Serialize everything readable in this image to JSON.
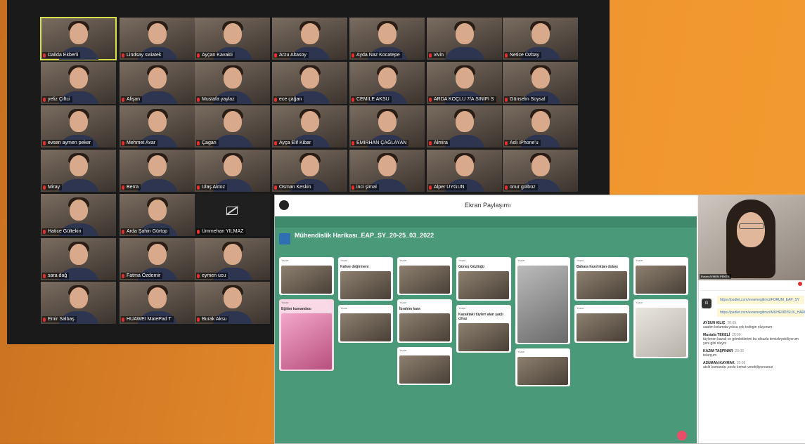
{
  "gallery": {
    "participants": [
      [
        "Dalida Ekberli",
        "Lindsay swiatek",
        "Ayçan Kavakli",
        "Arzu Altasoy",
        "Ayda Naz Kocatepe",
        "vivin",
        "Netice Özbay"
      ],
      [
        "yeliz Çiftci",
        "Alişan",
        "Mustafa yaylaz",
        "ece çağan",
        "CEMILE AKSU",
        "ARDA KOÇLU 7/A SINIFI S",
        "Günselin Soysal"
      ],
      [
        "evsen aymen peker",
        "Mehmet Avar",
        "Çagan",
        "Ayça Elif Kibar",
        "EMIRHAN ÇAĞLAYAN",
        "Almira",
        "Aslı iPhone'u"
      ],
      [
        "Miray",
        "Berra",
        "Ulaş Aktoz",
        "Osman Keskin",
        "inci şimal",
        "Alper UYGUN",
        "onur gülbüz"
      ],
      [
        "Hatice Gültekin",
        "Arda Şahin Gürtop",
        "Ümmehan YILMAZ"
      ],
      [
        "sara dağ",
        "Fatma Özdemir",
        "eymen ucu"
      ],
      [
        "Emir Salbaş",
        "HUAWEI MatePad T",
        "Burak Aksu"
      ]
    ]
  },
  "share": {
    "title": "Ekran Paylaşımı",
    "padlet_title": "Mühendislik Harikası_EAP_SY_20-25_03_2022",
    "columns": [
      [
        {
          "author": "Yazar",
          "title": "",
          "kind": "photo"
        },
        {
          "author": "Yazar",
          "title": "Eğitim kumandası",
          "kind": "pink"
        }
      ],
      [
        {
          "author": "Yazar",
          "title": "Kahve değirmeni",
          "kind": "photo"
        },
        {
          "author": "Yazar",
          "title": "",
          "kind": "photo"
        }
      ],
      [
        {
          "author": "Yazar",
          "title": "",
          "kind": "photo"
        },
        {
          "author": "Yazar",
          "title": "İbrahim kara",
          "kind": "photo"
        },
        {
          "author": "Yazar",
          "title": "",
          "kind": "photo"
        }
      ],
      [
        {
          "author": "Yazar",
          "title": "Güneş Gözlüğü",
          "kind": "photo"
        },
        {
          "author": "Yazar",
          "title": "Kazaktaki tüyleri alan şarjlı cihaz",
          "kind": "photo"
        }
      ],
      [
        {
          "author": "Yazar",
          "title": "",
          "kind": "gray"
        },
        {
          "author": "Yazar",
          "title": "",
          "kind": "photo"
        }
      ],
      [
        {
          "author": "Yazar",
          "title": "Bahara hazırlıktan dolayı",
          "kind": "photo"
        },
        {
          "author": "Yazar",
          "title": "",
          "kind": "photo"
        }
      ],
      [
        {
          "author": "Yazar",
          "title": "",
          "kind": "photo"
        },
        {
          "author": "Yazar",
          "title": "",
          "kind": "white"
        }
      ]
    ],
    "speaker_tag": "Evsen AYMEN PEKER",
    "chat": {
      "avatar": "G",
      "links": [
        "https://padlet.com/evsenegitimci/FORUM_EAP_SY",
        "https://padlet.com/evsenegitimci/MUHENDISLIK_HARIKASI_EAP_SY"
      ],
      "messages": [
        {
          "who": "AYSUN KILIÇ",
          "time": "20:09",
          "text": "saatim kolumda yoksa çok tedirgin oluyorum"
        },
        {
          "who": "Mustafa TEKELİ",
          "time": "20:09",
          "text": "tüylenen kazak ve gömleklerimi bu cihazla temizleyebiliyorum yeni gibi oluyor"
        },
        {
          "who": "KAZIM TAŞPINAR",
          "time": "20:09",
          "text": "telarçum"
        },
        {
          "who": "ASUMAN KAYMAK",
          "time": "20:09",
          "text": "akıllı kumanda ,sesle komut verebiliyorsunuz"
        }
      ]
    }
  }
}
